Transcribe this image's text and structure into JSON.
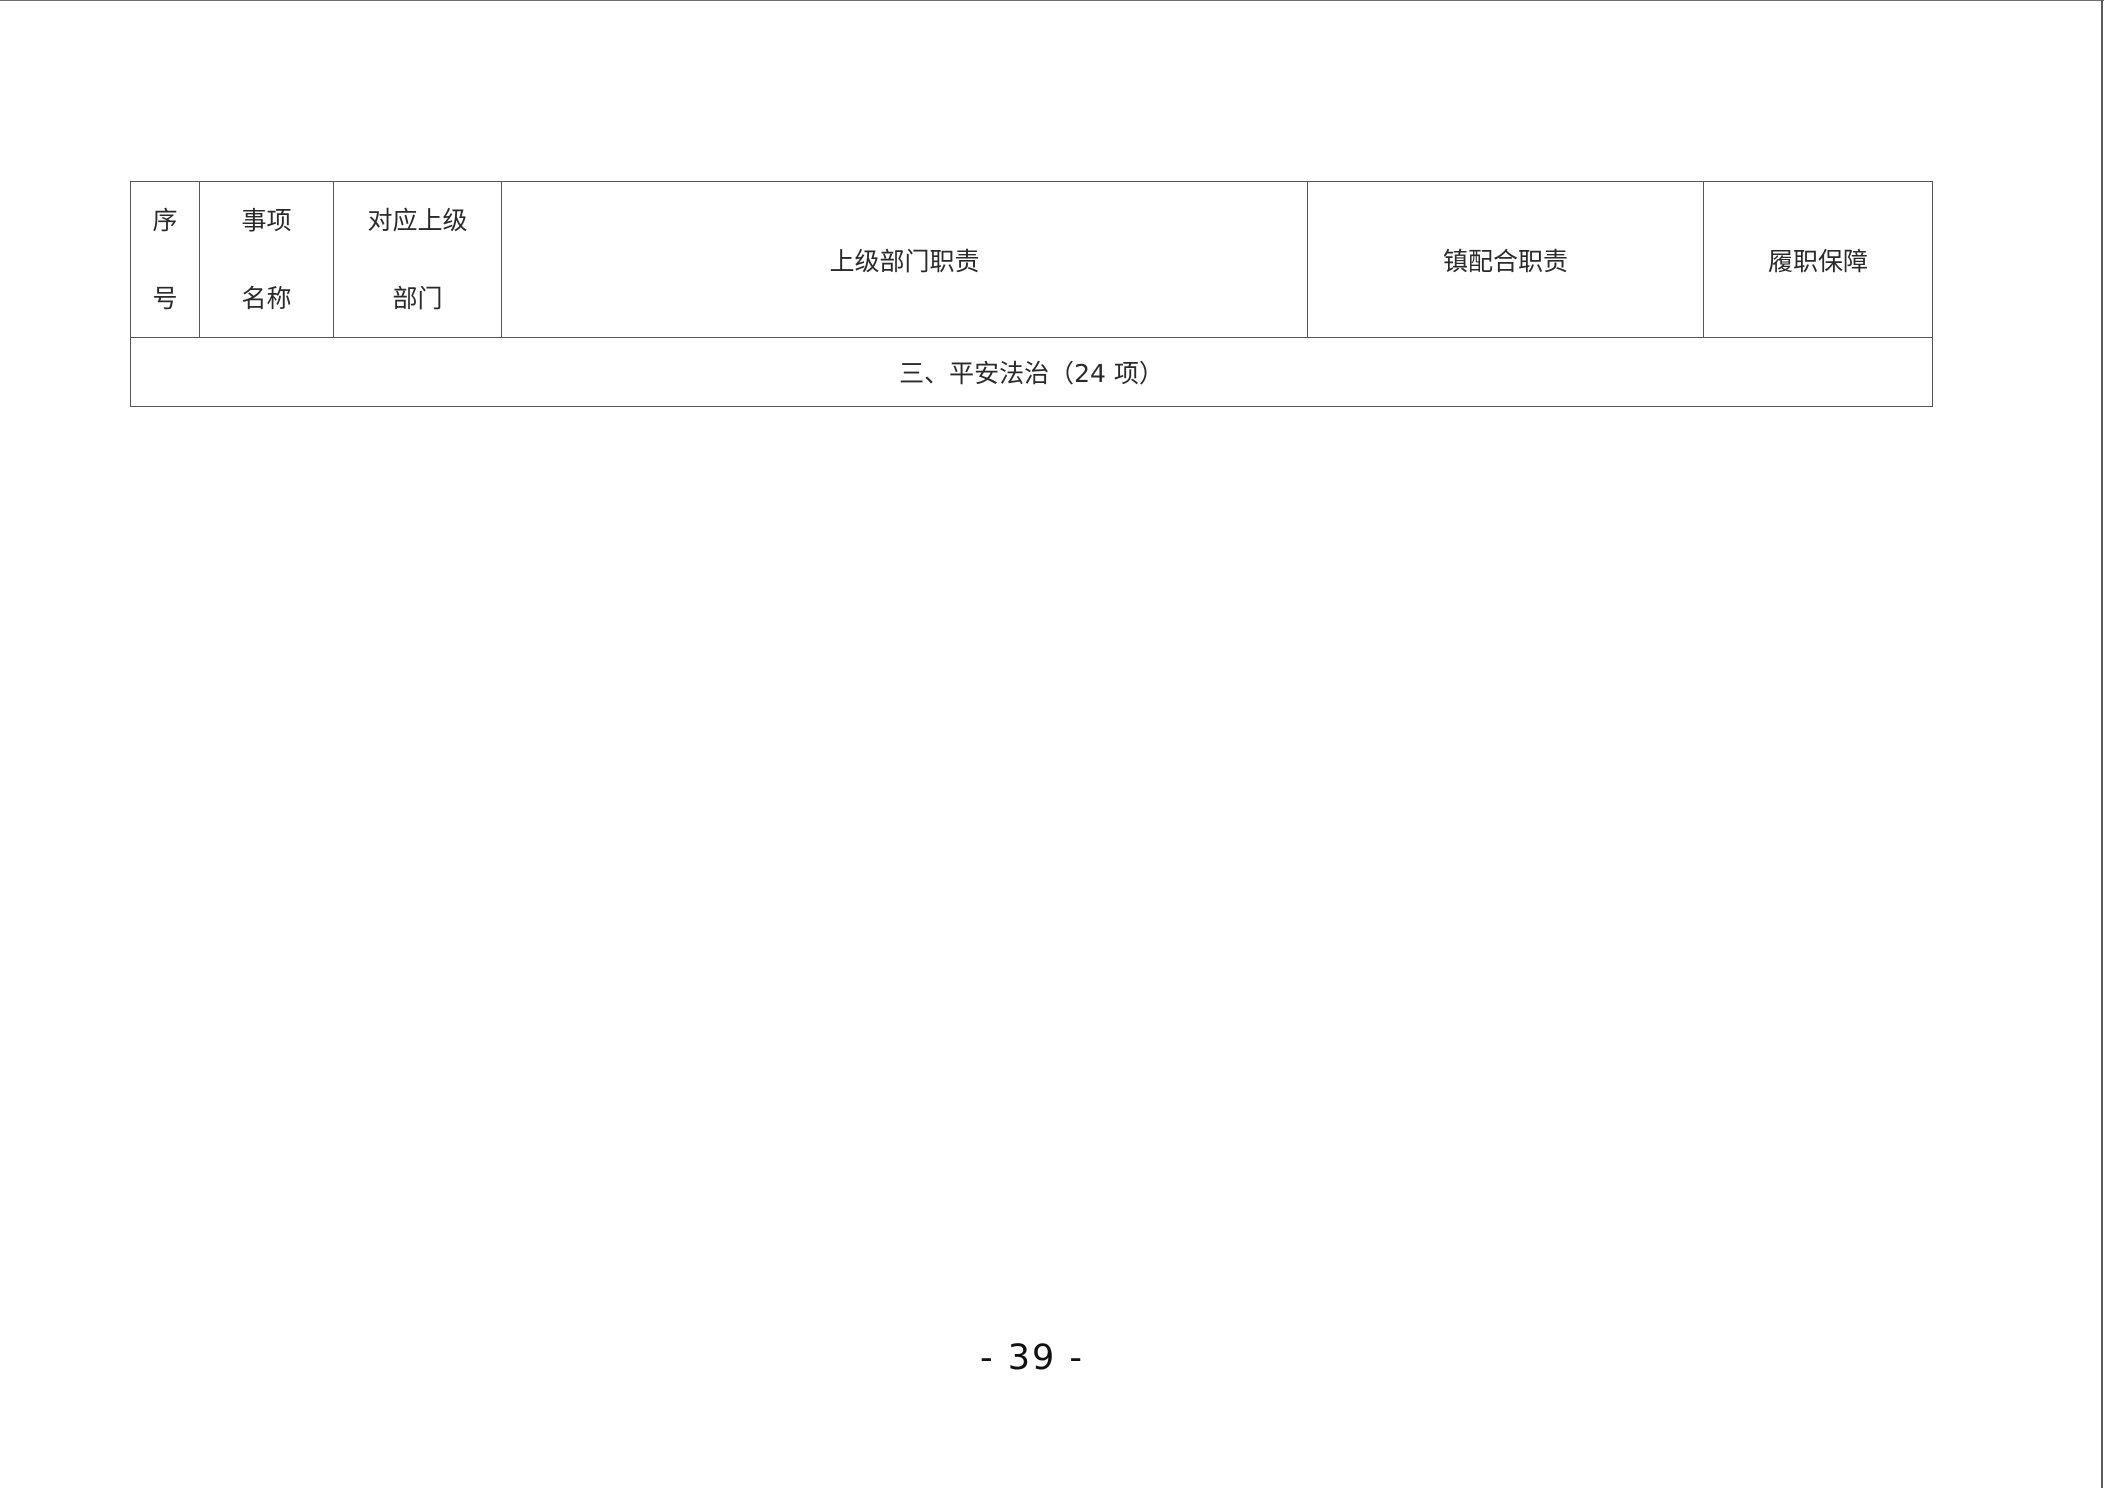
{
  "table": {
    "headers": {
      "seq": {
        "line1": "序",
        "line2": "号"
      },
      "item_name": {
        "line1": "事项",
        "line2": "名称"
      },
      "upper_dept": {
        "line1": "对应上级",
        "line2": "部门"
      },
      "upper_duty": "上级部门职责",
      "town_duty": "镇配合职责",
      "guarantee": "履职保障"
    },
    "section": "三、平安法治（24 项）"
  },
  "page_number": "-  39 -"
}
